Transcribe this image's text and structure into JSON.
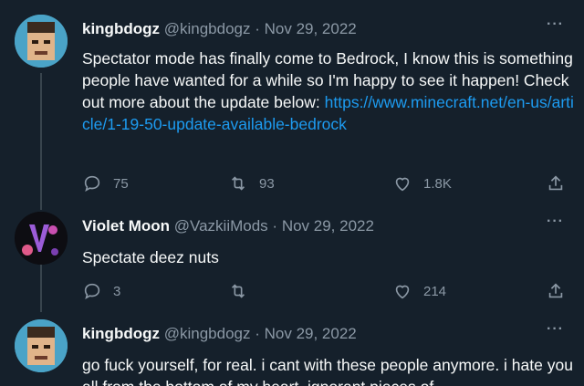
{
  "tweets": [
    {
      "name": "kingbdogz",
      "handle": "@kingbdogz",
      "sep": "·",
      "date": "Nov 29, 2022",
      "text": "Spectator mode has finally come to Bedrock, I know this is something people have wanted for a while so I'm happy to see it happen! Check out more about the update below:",
      "link": "https://www.minecraft.net/en-us/article/1-19-50-update-available-bedrock",
      "replies": "75",
      "retweets": "93",
      "likes": "1.8K",
      "more": "···"
    },
    {
      "name": "Violet Moon",
      "handle": "@VazkiiMods",
      "sep": "·",
      "date": "Nov 29, 2022",
      "text": "Spectate deez nuts",
      "replies": "3",
      "retweets": "",
      "likes": "214",
      "more": "···"
    },
    {
      "name": "kingbdogz",
      "handle": "@kingbdogz",
      "sep": "·",
      "date": "Nov 29, 2022",
      "text": "go fuck yourself, for real. i cant with these people anymore. i hate you all from the bottom of my heart. ignorant pieces of",
      "more": "···"
    }
  ],
  "colors": {
    "background": "#15202b",
    "text": "#f7f9f9",
    "muted": "#8b98a5",
    "link": "#1d9bf0"
  },
  "icons": [
    "reply-icon",
    "retweet-icon",
    "like-icon",
    "share-icon",
    "more-icon"
  ]
}
